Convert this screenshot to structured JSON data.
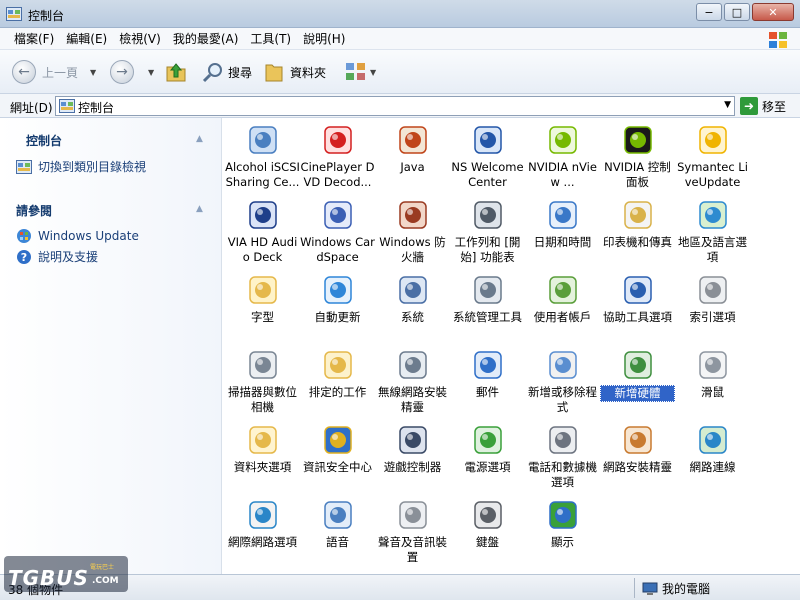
{
  "window": {
    "title": "控制台",
    "buttons": [
      "−",
      "□",
      "✕"
    ]
  },
  "menu": [
    "檔案(F)",
    "編輯(E)",
    "檢視(V)",
    "我的最愛(A)",
    "工具(T)",
    "說明(H)"
  ],
  "toolbar": {
    "back_label": "上一頁",
    "search_label": "搜尋",
    "folders_label": "資料夾"
  },
  "address": {
    "label": "網址(D)",
    "value": "控制台",
    "go_label": "移至"
  },
  "sidebar": {
    "section1_title": "控制台",
    "section1_link": "切換到類別目錄檢視",
    "section2_title": "請參閱",
    "links": [
      "Windows Update",
      "說明及支援"
    ]
  },
  "items": [
    {
      "label": "Alcohol iSCSI Sharing Ce...",
      "icon": "network-share-icon"
    },
    {
      "label": "CinePlayer DVD Decod...",
      "icon": "cineplayer-icon"
    },
    {
      "label": "Java",
      "icon": "java-icon"
    },
    {
      "label": "NS Welcome Center",
      "icon": "welcome-center-icon"
    },
    {
      "label": "NVIDIA nView ...",
      "icon": "nvidia-nview-icon"
    },
    {
      "label": "NVIDIA 控制面板",
      "icon": "nvidia-control-icon"
    },
    {
      "label": "Symantec LiveUpdate",
      "icon": "liveupdate-icon"
    },
    {
      "label": "VIA HD Audio Deck",
      "icon": "via-audio-icon"
    },
    {
      "label": "Windows CardSpace",
      "icon": "cardspace-icon"
    },
    {
      "label": "Windows 防火牆",
      "icon": "firewall-icon"
    },
    {
      "label": "工作列和 [開始] 功能表",
      "icon": "taskbar-icon"
    },
    {
      "label": "日期和時間",
      "icon": "calendar-icon"
    },
    {
      "label": "印表機和傳真",
      "icon": "printer-icon"
    },
    {
      "label": "地區及語言選項",
      "icon": "globe-icon"
    },
    {
      "label": "字型",
      "icon": "font-folder-icon"
    },
    {
      "label": "自動更新",
      "icon": "auto-update-icon"
    },
    {
      "label": "系統",
      "icon": "system-icon"
    },
    {
      "label": "系統管理工具",
      "icon": "admin-tools-icon"
    },
    {
      "label": "使用者帳戶",
      "icon": "user-accounts-icon"
    },
    {
      "label": "協助工具選項",
      "icon": "accessibility-icon"
    },
    {
      "label": "索引選項",
      "icon": "indexing-icon"
    },
    {
      "label": "掃描器與數位相機",
      "icon": "scanner-icon"
    },
    {
      "label": "排定的工作",
      "icon": "scheduled-tasks-icon"
    },
    {
      "label": "無線網路安裝精靈",
      "icon": "wireless-icon"
    },
    {
      "label": "郵件",
      "icon": "mail-icon"
    },
    {
      "label": "新增或移除程式",
      "icon": "add-remove-icon"
    },
    {
      "label": "新增硬體",
      "icon": "add-hardware-icon"
    },
    {
      "label": "滑鼠",
      "icon": "mouse-icon"
    },
    {
      "label": "資料夾選項",
      "icon": "folder-options-icon"
    },
    {
      "label": "資訊安全中心",
      "icon": "security-shield-icon"
    },
    {
      "label": "遊戲控制器",
      "icon": "gamepad-icon"
    },
    {
      "label": "電源選項",
      "icon": "power-icon"
    },
    {
      "label": "電話和數據機選項",
      "icon": "phone-icon"
    },
    {
      "label": "網路安裝精靈",
      "icon": "network-setup-icon"
    },
    {
      "label": "網路連線",
      "icon": "network-connections-icon"
    },
    {
      "label": "網際網路選項",
      "icon": "internet-options-icon"
    },
    {
      "label": "語音",
      "icon": "speech-icon"
    },
    {
      "label": "聲音及音訊裝置",
      "icon": "speaker-icon"
    },
    {
      "label": "鍵盤",
      "icon": "keyboard-icon"
    },
    {
      "label": "顯示",
      "icon": "display-icon"
    }
  ],
  "selected_index": 26,
  "status": {
    "left": "38 個物件",
    "right": "我的電腦"
  },
  "watermark": {
    "text": "TGBUS",
    "sub": "電玩巴士",
    "com": ".COM"
  }
}
